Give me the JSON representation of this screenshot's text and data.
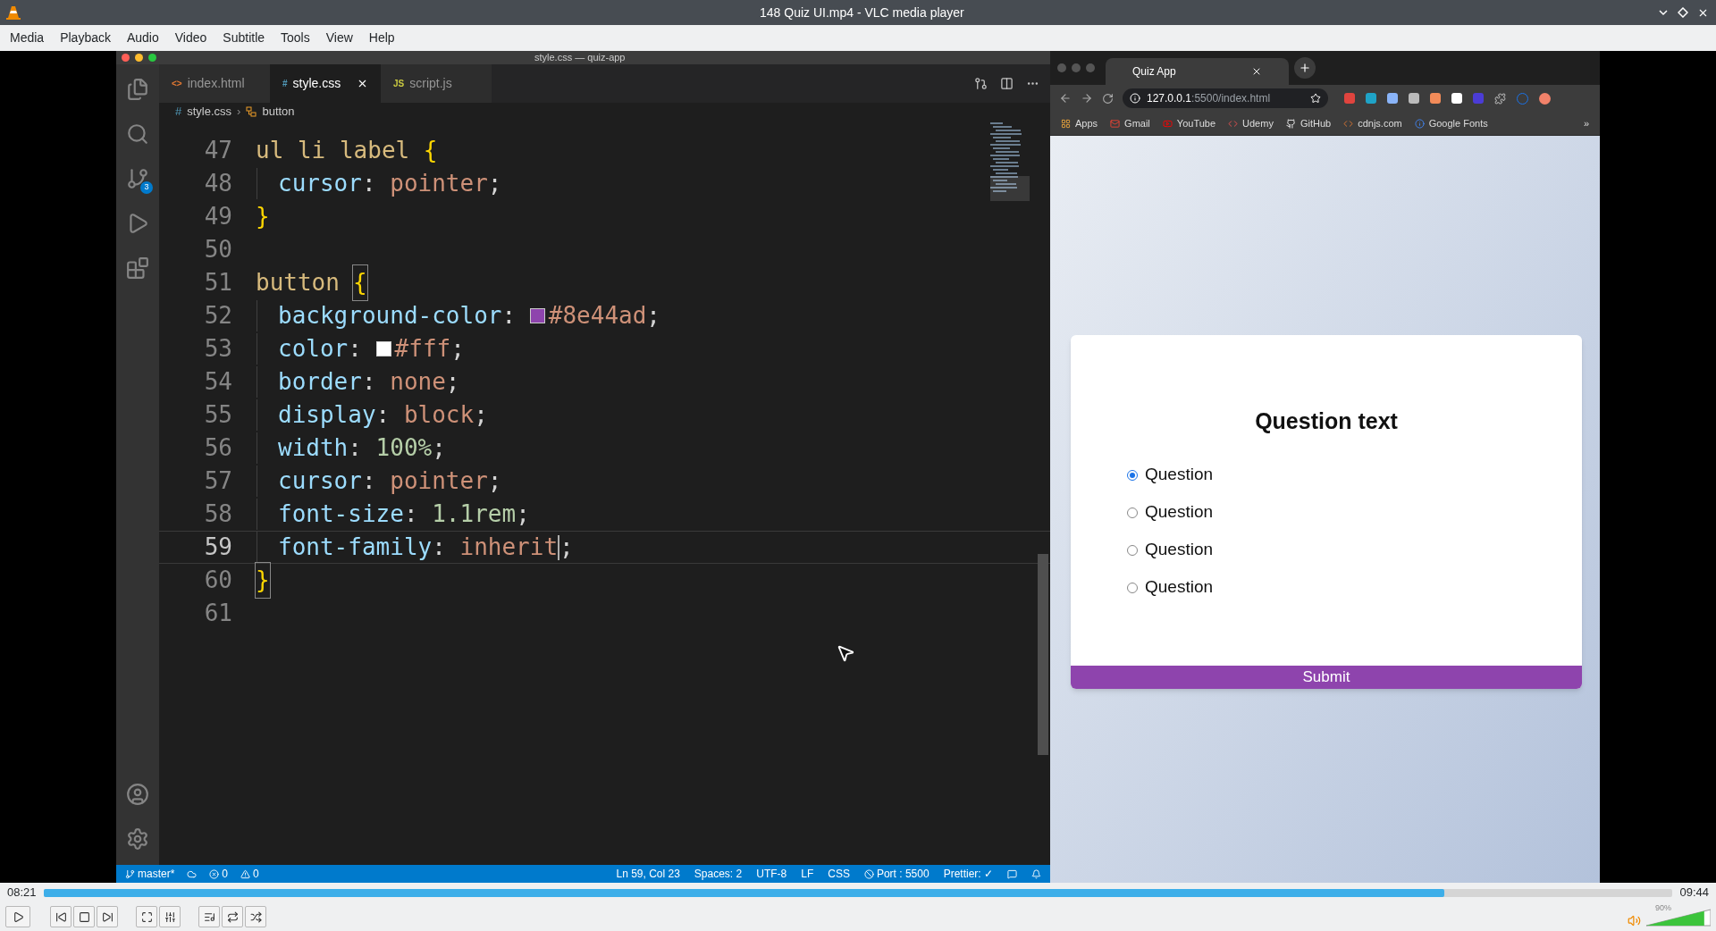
{
  "window": {
    "title": "148 Quiz UI.mp4 - VLC media player"
  },
  "menu": [
    "Media",
    "Playback",
    "Audio",
    "Video",
    "Subtitle",
    "Tools",
    "View",
    "Help"
  ],
  "editor": {
    "window_title": "style.css — quiz-app",
    "tabs": [
      {
        "label": "index.html",
        "icon": "<>",
        "kind": "html",
        "selected": false
      },
      {
        "label": "style.css",
        "icon": "#",
        "kind": "css",
        "selected": true
      },
      {
        "label": "script.js",
        "icon": "JS",
        "kind": "js",
        "selected": false
      }
    ],
    "breadcrumb": [
      {
        "icon": "#",
        "label": "style.css"
      },
      {
        "separator": "›",
        "label": "button"
      }
    ],
    "source_control_badge": "3",
    "lines": [
      {
        "number": "47",
        "kind": "rule",
        "current": false,
        "tokens": [
          {
            "text": "ul li label",
            "kind": "selector"
          },
          {
            "text": " {",
            "kind": "brace"
          }
        ]
      },
      {
        "number": "48",
        "kind": "declaration",
        "current": false,
        "tokens": [
          {
            "text": "cursor",
            "kind": "property"
          },
          {
            "text": ": ",
            "kind": "punct"
          },
          {
            "text": "pointer",
            "kind": "value"
          },
          {
            "text": ";",
            "kind": "punct"
          }
        ]
      },
      {
        "number": "49",
        "kind": "rule",
        "current": false,
        "tokens": [
          {
            "text": "}",
            "kind": "brace"
          }
        ]
      },
      {
        "number": "50",
        "kind": "blank",
        "current": false
      },
      {
        "number": "51",
        "kind": "rule",
        "current": false,
        "tokens": [
          {
            "text": "button",
            "kind": "selector"
          },
          {
            "kind": "space"
          },
          {
            "text": "{",
            "kind": "brace-match"
          }
        ]
      },
      {
        "number": "52",
        "kind": "declaration",
        "current": false,
        "tokens": [
          {
            "text": "background-color",
            "kind": "property"
          },
          {
            "text": ": ",
            "kind": "punct"
          },
          {
            "kind": "swatch",
            "color": "#8e44ad"
          },
          {
            "text": "#8e44ad",
            "kind": "value"
          },
          {
            "text": ";",
            "kind": "punct"
          }
        ]
      },
      {
        "number": "53",
        "kind": "declaration",
        "current": false,
        "tokens": [
          {
            "text": "color",
            "kind": "property"
          },
          {
            "text": ": ",
            "kind": "punct"
          },
          {
            "kind": "swatch",
            "color": "#ffffff"
          },
          {
            "text": "#fff",
            "kind": "value"
          },
          {
            "text": ";",
            "kind": "punct"
          }
        ]
      },
      {
        "number": "54",
        "kind": "declaration",
        "current": false,
        "tokens": [
          {
            "text": "border",
            "kind": "property"
          },
          {
            "text": ": ",
            "kind": "punct"
          },
          {
            "text": "none",
            "kind": "value"
          },
          {
            "text": ";",
            "kind": "punct"
          }
        ]
      },
      {
        "number": "55",
        "kind": "declaration",
        "current": false,
        "tokens": [
          {
            "text": "display",
            "kind": "property"
          },
          {
            "text": ": ",
            "kind": "punct"
          },
          {
            "text": "block",
            "kind": "value"
          },
          {
            "text": ";",
            "kind": "punct"
          }
        ]
      },
      {
        "number": "56",
        "kind": "declaration",
        "current": false,
        "tokens": [
          {
            "text": "width",
            "kind": "property"
          },
          {
            "text": ": ",
            "kind": "punct"
          },
          {
            "text": "100%",
            "kind": "number"
          },
          {
            "text": ";",
            "kind": "punct"
          }
        ]
      },
      {
        "number": "57",
        "kind": "declaration",
        "current": false,
        "tokens": [
          {
            "text": "cursor",
            "kind": "property"
          },
          {
            "text": ": ",
            "kind": "punct"
          },
          {
            "text": "pointer",
            "kind": "value"
          },
          {
            "text": ";",
            "kind": "punct"
          }
        ]
      },
      {
        "number": "58",
        "kind": "declaration",
        "current": false,
        "tokens": [
          {
            "text": "font-size",
            "kind": "property"
          },
          {
            "text": ": ",
            "kind": "punct"
          },
          {
            "text": "1.1rem",
            "kind": "number"
          },
          {
            "text": ";",
            "kind": "punct"
          }
        ]
      },
      {
        "number": "59",
        "kind": "declaration",
        "current": true,
        "tokens": [
          {
            "text": "font-family",
            "kind": "property"
          },
          {
            "text": ": ",
            "kind": "punct"
          },
          {
            "text": "inherit",
            "kind": "value"
          },
          {
            "kind": "caret"
          },
          {
            "text": ";",
            "kind": "punct"
          }
        ]
      },
      {
        "number": "60",
        "kind": "rule",
        "current": false,
        "tokens": [
          {
            "text": "}",
            "kind": "brace-match"
          }
        ]
      },
      {
        "number": "61",
        "kind": "blank",
        "current": false
      }
    ],
    "status_left": [
      {
        "kind": "branch",
        "text": "master*"
      },
      {
        "kind": "sync"
      },
      {
        "kind": "errors",
        "text": "0"
      },
      {
        "kind": "warnings",
        "text": "0"
      }
    ],
    "status_right": [
      {
        "kind": "text",
        "text": "Ln 59, Col 23"
      },
      {
        "kind": "text",
        "text": "Spaces: 2"
      },
      {
        "kind": "text",
        "text": "UTF-8"
      },
      {
        "kind": "text",
        "text": "LF"
      },
      {
        "kind": "text",
        "text": "CSS"
      },
      {
        "kind": "port",
        "text": "Port : 5500"
      },
      {
        "kind": "text",
        "text": "Prettier: ✓"
      },
      {
        "kind": "feedback"
      },
      {
        "kind": "bell"
      }
    ]
  },
  "browser": {
    "tab_title": "Quiz App",
    "url_host": "127.0.0.1",
    "url_path": ":5500/index.html",
    "bookmarks": [
      {
        "label": "Apps",
        "kind": "apps"
      },
      {
        "label": "Gmail",
        "kind": "gmail"
      },
      {
        "label": "YouTube",
        "kind": "youtube"
      },
      {
        "label": "Udemy",
        "kind": "udemy"
      },
      {
        "label": "GitHub",
        "kind": "github"
      },
      {
        "label": "cdnjs.com",
        "kind": "code"
      },
      {
        "label": "Google Fonts",
        "kind": "fonts"
      }
    ],
    "bookmarks_more": "»",
    "quiz": {
      "question": "Question text",
      "options": [
        {
          "label": "Question",
          "selected": true
        },
        {
          "label": "Question",
          "selected": false
        },
        {
          "label": "Question",
          "selected": false
        },
        {
          "label": "Question",
          "selected": false
        }
      ],
      "submit": "Submit"
    }
  },
  "player": {
    "elapsed": "08:21",
    "total": "09:44",
    "level": 0.86,
    "volume": {
      "reading": "90%",
      "level": 0.9
    }
  }
}
